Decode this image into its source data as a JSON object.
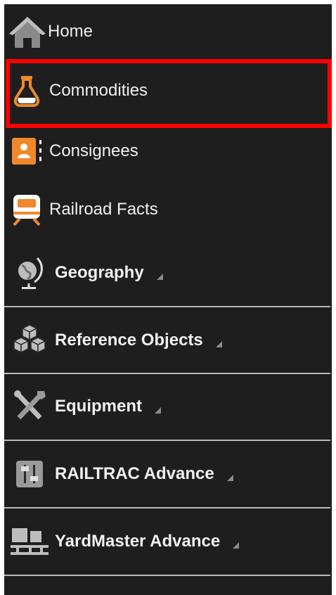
{
  "colors": {
    "sidebar_bg": "#1e1e1e",
    "accent_orange": "#f0882a",
    "icon_gray": "#8a8a8a",
    "highlight_red": "#ff0000",
    "divider": "#b9b9b9"
  },
  "menu": {
    "home": {
      "label": "Home",
      "icon": "home-icon"
    },
    "commodities": {
      "label": "Commodities",
      "icon": "flask-icon",
      "selected": true
    },
    "consignees": {
      "label": "Consignees",
      "icon": "contact-card-icon"
    },
    "railroad_facts": {
      "label": "Railroad Facts",
      "icon": "train-icon"
    },
    "geography": {
      "label": "Geography",
      "icon": "globe-icon",
      "expandable": true
    },
    "reference_objects": {
      "label": "Reference Objects",
      "icon": "cubes-icon",
      "expandable": true
    },
    "equipment": {
      "label": "Equipment",
      "icon": "tools-icon",
      "expandable": true
    },
    "railtrac_advance": {
      "label": "RAILTRAC Advance",
      "icon": "sliders-icon",
      "expandable": true
    },
    "yardmaster_advance": {
      "label": "YardMaster Advance",
      "icon": "yard-icon",
      "expandable": true
    }
  }
}
